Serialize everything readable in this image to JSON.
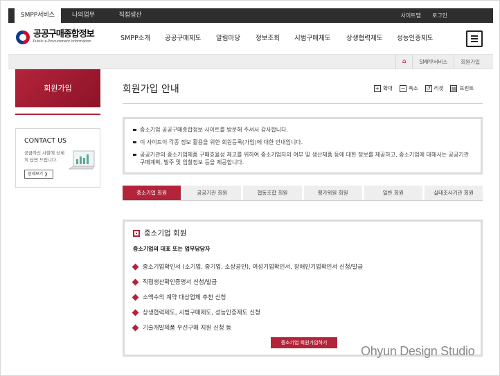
{
  "topbar": {
    "tabs": [
      "SMPP서비스",
      "나의업무",
      "직접생산"
    ],
    "util": [
      "사이트맵",
      "로그인"
    ]
  },
  "header": {
    "logo_title": "공공구매종합정보",
    "logo_sub": "Public e-Procurement information",
    "gnb": [
      "SMPP소개",
      "공공구매제도",
      "알림마당",
      "정보조회",
      "시범구매제도",
      "상생협력제도",
      "성능인증제도"
    ],
    "menu_icon": "hamburger-icon"
  },
  "breadcrumb": {
    "home_icon": "home-icon",
    "items": [
      "SMPP서비스",
      "회원가입"
    ]
  },
  "sidebar": {
    "title": "회원가입",
    "contact": {
      "title": "CONTACT US",
      "desc": "궁금하신 사항에 상세히 답변 드립니다.",
      "button": "상세보기 ❯"
    }
  },
  "main": {
    "title": "회원가입 안내",
    "tools": [
      {
        "icon": "+",
        "label": "확대"
      },
      {
        "icon": "−",
        "label": "축소"
      },
      {
        "icon": "↺",
        "label": "리셋"
      },
      {
        "icon": "▤",
        "label": "프린트"
      }
    ],
    "info": [
      "중소기업 공공구매종합정보 사이트를 방문해 주셔서 감사합니다.",
      "이 사이트이 각종 정보 활용을 위한 회원등록(가입)에 대한 안내입니다.",
      "공공기관의 중소기업제품 구매효율성 제고를 위하여 중소기업자의 여부 및 생산제품 등에 대한 정보를 제공하고, 중소기업에 대해서는 공공기관 구매계획, 발주 및 입찰정보 등을 제공합니다."
    ],
    "tabs": [
      "중소기업 회원",
      "공공기관 회원",
      "협동조합 회원",
      "평가위원 회원",
      "일반 회원",
      "실태조사기관 회원"
    ],
    "active_tab": 0,
    "detail": {
      "title": "중소기업 회원",
      "subtitle": "중소기업의 대표 또는 업무담당자",
      "items": [
        "중소기업확인서 (소기업, 중기업, 소상공인), 여성기업확인서, 장애인기업확인서 신청/발급",
        "직접생산확인증명서 신청/발급",
        "소액수의 계약 대상업체 추천 신청",
        "상생협력제도, 시범구매제도, 성능인증제도 신청",
        "기술개발제품 우선구매 지원 신청 등"
      ],
      "button": "중소기업 회원가입하기"
    }
  },
  "watermark": "Ohyun Design Studio",
  "colors": {
    "accent": "#b3243b",
    "topbar": "#2e2e2e"
  }
}
